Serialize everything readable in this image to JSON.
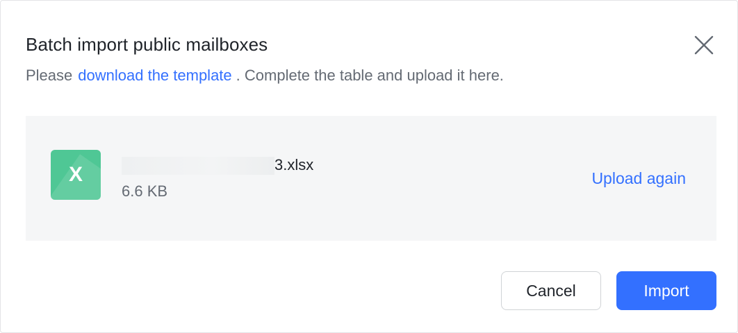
{
  "dialog": {
    "title": "Batch import public mailboxes",
    "close_icon": "close-icon",
    "instructions": {
      "prefix": "Please",
      "link_text": "download the template",
      "suffix": ". Complete the table and upload it here."
    }
  },
  "file": {
    "icon": "excel-file-icon",
    "icon_letter": "X",
    "icon_color": "#4fc795",
    "name_visible_suffix": "3.xlsx",
    "size": "6.6 KB",
    "upload_again_label": "Upload again"
  },
  "footer": {
    "cancel_label": "Cancel",
    "import_label": "Import",
    "primary_color": "#3370ff"
  }
}
